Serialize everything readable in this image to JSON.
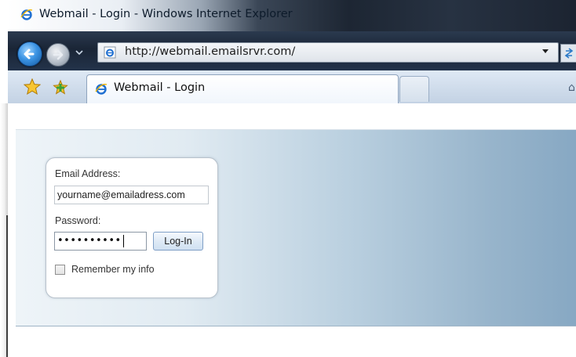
{
  "window": {
    "title": "Webmail - Login - Windows Internet Explorer",
    "url": "http://webmail.emailsrvr.com/"
  },
  "tabs": [
    {
      "label": "Webmail - Login",
      "active": true
    }
  ],
  "icons": {
    "app": "ie-logo-icon",
    "back": "back-arrow-icon",
    "forward": "forward-arrow-icon",
    "favorites": "favorites-star-icon",
    "add_favorites": "add-favorites-icon",
    "refresh": "refresh-icon"
  },
  "login": {
    "email_label": "Email Address:",
    "email_value": "yourname@emailadress.com",
    "password_label": "Password:",
    "password_value": "••••••••••",
    "login_button": "Log-In",
    "remember_label": "Remember my info",
    "remember_checked": false
  },
  "colors": {
    "banner_start": "#eef4f8",
    "banner_end": "#87a8c3",
    "button_border": "#7f9fc6"
  }
}
